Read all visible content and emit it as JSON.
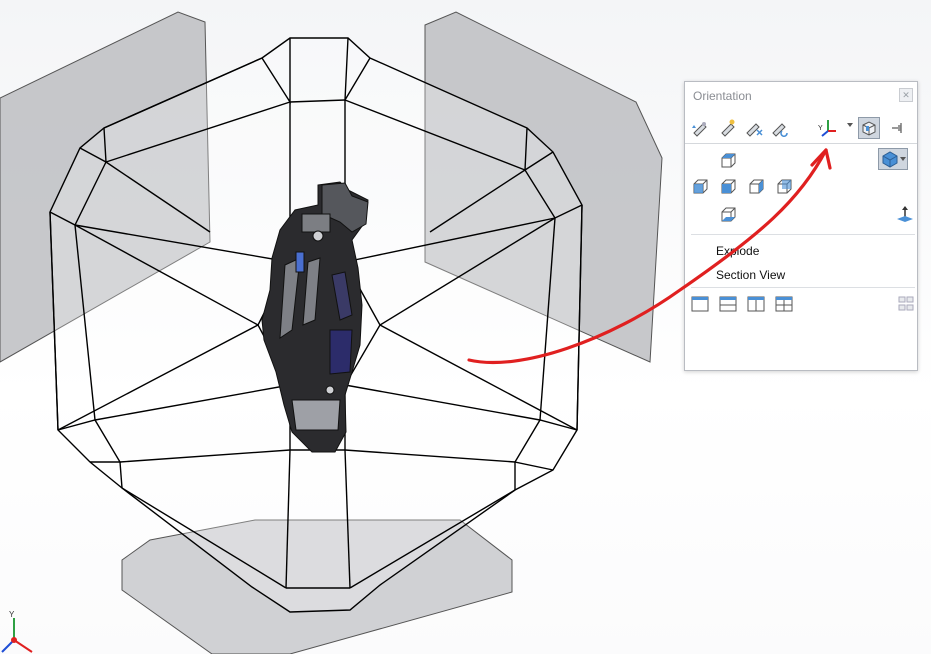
{
  "orientation_panel": {
    "title": "Orientation",
    "menu": {
      "explode_label": "Explode",
      "section_view_label": "Section View"
    },
    "icons": {
      "close": "close-icon",
      "toolbar": [
        "new-view-icon",
        "update-view-icon",
        "reset-views-icon",
        "link-views-icon",
        "triad-icon",
        "view-selector-icon",
        "pin-icon"
      ],
      "views": [
        "top-view-icon",
        "left-view-icon",
        "front-view-icon",
        "right-view-icon",
        "back-view-icon",
        "bottom-view-icon",
        "isometric-view-icon",
        "normal-to-icon"
      ],
      "layouts": [
        "single-view-icon",
        "two-view-horizontal-icon",
        "two-view-vertical-icon",
        "four-view-icon",
        "link-layouts-icon"
      ]
    }
  },
  "colors": {
    "accent_blue": "#4a90d6",
    "annotation_red": "#e02020",
    "panel_border": "#b9bcc2"
  }
}
